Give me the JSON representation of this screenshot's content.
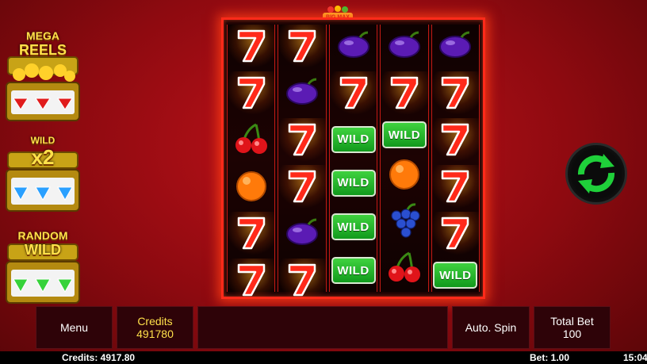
{
  "game": {
    "logo_text": "BIG MAX"
  },
  "features": [
    {
      "title": "MEGA\nREELS",
      "line1": "MEGA",
      "line2": "REELS",
      "gem_color": "#e01c1c"
    },
    {
      "title": "WILD x2",
      "line1": "WILD",
      "line2": "x2",
      "gem_color": "#2aa0ff"
    },
    {
      "title": "RANDOM WILD",
      "line1": "RANDOM",
      "line2": "WILD",
      "gem_color": "#36d23a"
    }
  ],
  "reels": [
    [
      "seven",
      "seven",
      "cherry",
      "orange",
      "seven",
      "seven"
    ],
    [
      "seven",
      "plum",
      "seven",
      "seven",
      "plum",
      "seven"
    ],
    [
      "plum",
      "seven",
      "wild",
      "wild",
      "wild",
      "wild"
    ],
    [
      "plum",
      "seven",
      "wild",
      "orange",
      "grapes",
      "cherry"
    ],
    [
      "plum",
      "seven",
      "seven",
      "seven",
      "seven",
      "wild"
    ]
  ],
  "symbols": {
    "wild_label": "WILD"
  },
  "controls": {
    "menu_label": "Menu",
    "credits_label": "Credits",
    "credits_value": "491780",
    "message": "",
    "autospin_label": "Auto. Spin",
    "totalbet_label": "Total Bet",
    "totalbet_value": "100",
    "spin_icon": "refresh-arrows-icon"
  },
  "status_bar": {
    "credits": "Credits: 4917.80",
    "bet": "Bet: 1.00",
    "time": "15:04"
  },
  "colors": {
    "frame": "#ff2a1a",
    "bar_bg": "#2e0308",
    "accent": "#ffe04a",
    "spin_green": "#1fd03a"
  }
}
